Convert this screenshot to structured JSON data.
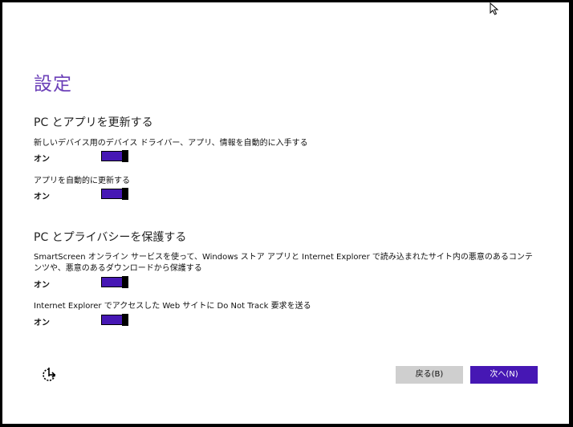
{
  "page": {
    "title": "設定"
  },
  "sections": [
    {
      "title": "PC とアプリを更新する",
      "settings": [
        {
          "description": "新しいデバイス用のデバイス ドライバー、アプリ、情報を自動的に入手する",
          "state_label": "オン",
          "on": true
        },
        {
          "description": "アプリを自動的に更新する",
          "state_label": "オン",
          "on": true
        }
      ]
    },
    {
      "title": "PC とプライバシーを保護する",
      "settings": [
        {
          "description": "SmartScreen オンライン サービスを使って、Windows ストア アプリと Internet Explorer で読み込まれたサイト内の悪意のあるコンテンツや、悪意のあるダウンロードから保護する",
          "state_label": "オン",
          "on": true
        },
        {
          "description": "Internet Explorer でアクセスした Web サイトに Do Not Track 要求を送る",
          "state_label": "オン",
          "on": true
        }
      ]
    }
  ],
  "footer": {
    "accessibility_icon": "ease-of-access-icon",
    "back_label": "戻る(B)",
    "next_label": "次へ(N)"
  },
  "colors": {
    "accent": "#4617b4",
    "title": "#6b3fb8",
    "back_button": "#cfcfcf"
  }
}
